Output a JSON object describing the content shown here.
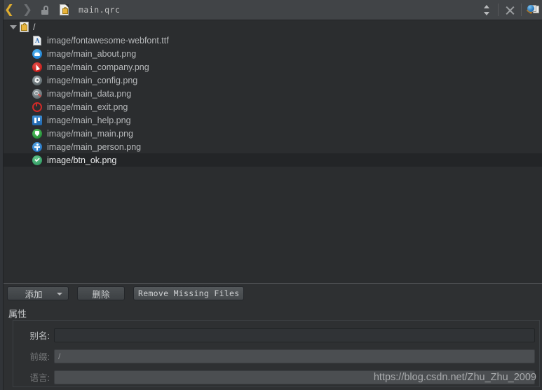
{
  "toolbar": {
    "back_icon": "arrow-back-icon",
    "forward_icon": "arrow-forward-icon",
    "lock_icon": "unlocked-padlock-icon",
    "file_icon": "qrc-file-icon",
    "filename": "main.qrc",
    "spinner_icon": "up-down-spinner-icon",
    "close_icon": "close-x-icon",
    "split_icon": "open-in-browser-icon"
  },
  "tree": {
    "root": {
      "label": "/",
      "icon": "qrc-resource-icon",
      "expanded": true
    },
    "files": [
      {
        "label": "image/fontawesome-webfont.ttf",
        "icon": "font-file-icon",
        "kind": "ttf",
        "selected": false
      },
      {
        "label": "image/main_about.png",
        "icon": "about-icon",
        "kind": "about",
        "selected": false
      },
      {
        "label": "image/main_company.png",
        "icon": "company-icon",
        "kind": "company",
        "selected": false
      },
      {
        "label": "image/main_config.png",
        "icon": "gear-icon",
        "kind": "config",
        "selected": false
      },
      {
        "label": "image/main_data.png",
        "icon": "magnifier-icon",
        "kind": "data",
        "selected": false
      },
      {
        "label": "image/main_exit.png",
        "icon": "power-exit-icon",
        "kind": "exit",
        "selected": false
      },
      {
        "label": "image/main_help.png",
        "icon": "help-icon",
        "kind": "help",
        "selected": false
      },
      {
        "label": "image/main_main.png",
        "icon": "shield-icon",
        "kind": "main",
        "selected": false
      },
      {
        "label": "image/main_person.png",
        "icon": "person-icon",
        "kind": "person",
        "selected": false
      },
      {
        "label": "image/btn_ok.png",
        "icon": "check-ok-icon",
        "kind": "ok",
        "selected": true
      }
    ]
  },
  "buttons": {
    "add": "添加",
    "add_dropdown_icon": "chevron-down-icon",
    "remove": "删除",
    "remove_missing": "Remove Missing Files"
  },
  "properties": {
    "title": "属性",
    "fields": [
      {
        "label": "别名:",
        "value": "",
        "disabled": false
      },
      {
        "label": "前缀:",
        "value": "/",
        "disabled": true
      },
      {
        "label": "语言:",
        "value": "",
        "disabled": true
      }
    ]
  },
  "watermark": "https://blog.csdn.net/Zhu_Zhu_2009",
  "colors": {
    "toolbar_bg": "#414447",
    "tree_bg": "#2b2d2f",
    "panel_bg": "#2e3032",
    "selection_bg": "#232527",
    "text": "#b6b8ba",
    "accent_back_arrow": "#e0ae2f"
  }
}
